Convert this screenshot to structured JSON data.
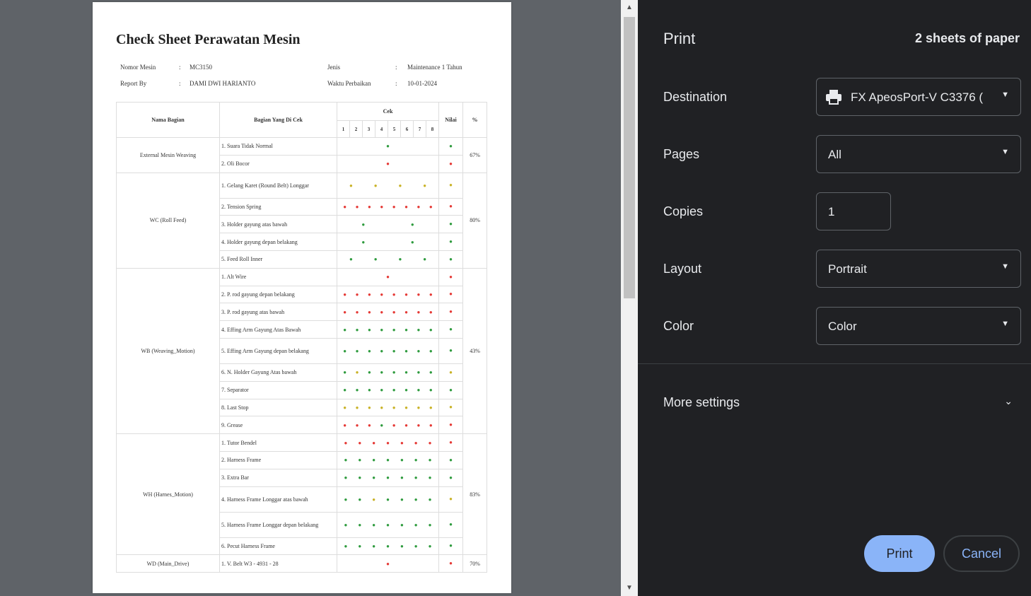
{
  "document": {
    "title": "Check Sheet Perawatan Mesin",
    "info": [
      {
        "label": "Nomor Mesin",
        "value": "MC3150"
      },
      {
        "label": "Report By",
        "value": "DAMI DWI HARIANTO"
      },
      {
        "label": "Jenis",
        "value": "Maintenance 1 Tahun"
      },
      {
        "label": "Waktu Perbaikan",
        "value": "10-01-2024"
      }
    ],
    "headers": {
      "nama_bagian": "Nama Bagian",
      "bagian_cek": "Bagian Yang Di Cek",
      "cek": "Cek",
      "nilai": "Nilai",
      "pct": "%"
    },
    "cek_cols": [
      "1",
      "2",
      "3",
      "4",
      "5",
      "6",
      "7",
      "8"
    ],
    "groups": [
      {
        "name": "External Mesin Weaving",
        "pct": "67%",
        "rows": [
          {
            "item": "1. Suara Tidak Normal",
            "dots": [
              "g"
            ],
            "nilai": "g"
          },
          {
            "item": "2. Oli Bocor",
            "dots": [
              "r"
            ],
            "nilai": "r"
          }
        ]
      },
      {
        "name": "WC (Roll Feed)",
        "pct": "80%",
        "rows": [
          {
            "item": "1. Gelang Karet (Round Belt) Longgar",
            "dots": [
              "y",
              "y",
              "y",
              "y"
            ],
            "nilai": "y"
          },
          {
            "item": "2. Tension Spring",
            "dots": [
              "r",
              "r",
              "r",
              "r",
              "r",
              "r",
              "r",
              "r"
            ],
            "nilai": "r"
          },
          {
            "item": "3. Holder gayung atas bawah",
            "dots": [
              "g",
              "g"
            ],
            "nilai": "g"
          },
          {
            "item": "4. Holder gayung depan belakang",
            "dots": [
              "g",
              "g"
            ],
            "nilai": "g"
          },
          {
            "item": "5. Feed Roll Inner",
            "dots": [
              "g",
              "g",
              "g",
              "g"
            ],
            "nilai": "g"
          }
        ]
      },
      {
        "name": "WB (Weaving_Motion)",
        "pct": "43%",
        "rows": [
          {
            "item": "1. Alt Wire",
            "dots": [
              "r"
            ],
            "nilai": "r"
          },
          {
            "item": "2. P. rod gayung depan belakang",
            "dots": [
              "r",
              "r",
              "r",
              "r",
              "r",
              "r",
              "r",
              "r"
            ],
            "nilai": "r"
          },
          {
            "item": "3. P. rod gayung atas bawah",
            "dots": [
              "r",
              "r",
              "r",
              "r",
              "r",
              "r",
              "r",
              "r"
            ],
            "nilai": "r"
          },
          {
            "item": "4. Effing Arm Gayung Atas Bawah",
            "dots": [
              "g",
              "g",
              "g",
              "g",
              "g",
              "g",
              "g",
              "g"
            ],
            "nilai": "g"
          },
          {
            "item": "5. Effing Arm Gayung depan belakang",
            "dots": [
              "g",
              "g",
              "g",
              "g",
              "g",
              "g",
              "g",
              "g"
            ],
            "nilai": "g"
          },
          {
            "item": "6. N. Holder Gayung Atas bawah",
            "dots": [
              "g",
              "y",
              "g",
              "g",
              "g",
              "g",
              "g",
              "g"
            ],
            "nilai": "y"
          },
          {
            "item": "7. Separator",
            "dots": [
              "g",
              "g",
              "g",
              "g",
              "g",
              "g",
              "g",
              "g"
            ],
            "nilai": "g"
          },
          {
            "item": "8. Last Stop",
            "dots": [
              "y",
              "y",
              "y",
              "y",
              "y",
              "y",
              "y",
              "y"
            ],
            "nilai": "y"
          },
          {
            "item": "9. Grease",
            "dots": [
              "r",
              "r",
              "r",
              "g",
              "r",
              "r",
              "r",
              "r"
            ],
            "nilai": "r"
          }
        ]
      },
      {
        "name": "WH (Harnes_Motion)",
        "pct": "83%",
        "rows": [
          {
            "item": "1. Tutor Bendel",
            "dots": [
              "r",
              "r",
              "r",
              "r",
              "r",
              "r",
              "r"
            ],
            "nilai": "r"
          },
          {
            "item": "2. Harness Frame",
            "dots": [
              "g",
              "g",
              "g",
              "g",
              "g",
              "g",
              "g"
            ],
            "nilai": "g"
          },
          {
            "item": "3. Extra Bar",
            "dots": [
              "g",
              "g",
              "g",
              "g",
              "g",
              "g",
              "g"
            ],
            "nilai": "g"
          },
          {
            "item": "4. Harness Frame Longgar atas bawah",
            "dots": [
              "g",
              "g",
              "y",
              "g",
              "g",
              "g",
              "g"
            ],
            "nilai": "y"
          },
          {
            "item": "5. Harness Frame Longgar depan belakang",
            "dots": [
              "g",
              "g",
              "g",
              "g",
              "g",
              "g",
              "g"
            ],
            "nilai": "g"
          },
          {
            "item": "6. Pecut Harness Frame",
            "dots": [
              "g",
              "g",
              "g",
              "g",
              "g",
              "g",
              "g"
            ],
            "nilai": "g"
          }
        ]
      },
      {
        "name": "WD (Main_Drive)",
        "pct": "70%",
        "rows": [
          {
            "item": "1. V. Belt W3 - 4931 - 28",
            "dots": [
              "r"
            ],
            "nilai": "r"
          }
        ]
      }
    ]
  },
  "sidebar": {
    "title": "Print",
    "sheets": "2 sheets of paper",
    "destination": {
      "label": "Destination",
      "value": "FX ApeosPort-V C3376 (",
      "icon": "printer-icon"
    },
    "pages": {
      "label": "Pages",
      "value": "All"
    },
    "copies": {
      "label": "Copies",
      "value": "1"
    },
    "layout": {
      "label": "Layout",
      "value": "Portrait"
    },
    "color": {
      "label": "Color",
      "value": "Color"
    },
    "more_settings": "More settings",
    "print_button": "Print",
    "cancel_button": "Cancel"
  },
  "colors": {
    "accent": "#8ab4f8",
    "sidebar_bg": "#202124",
    "preview_bg": "#5f6368",
    "dot_green": "#2e9b3e",
    "dot_red": "#e53935",
    "dot_yellow": "#c9b227"
  }
}
